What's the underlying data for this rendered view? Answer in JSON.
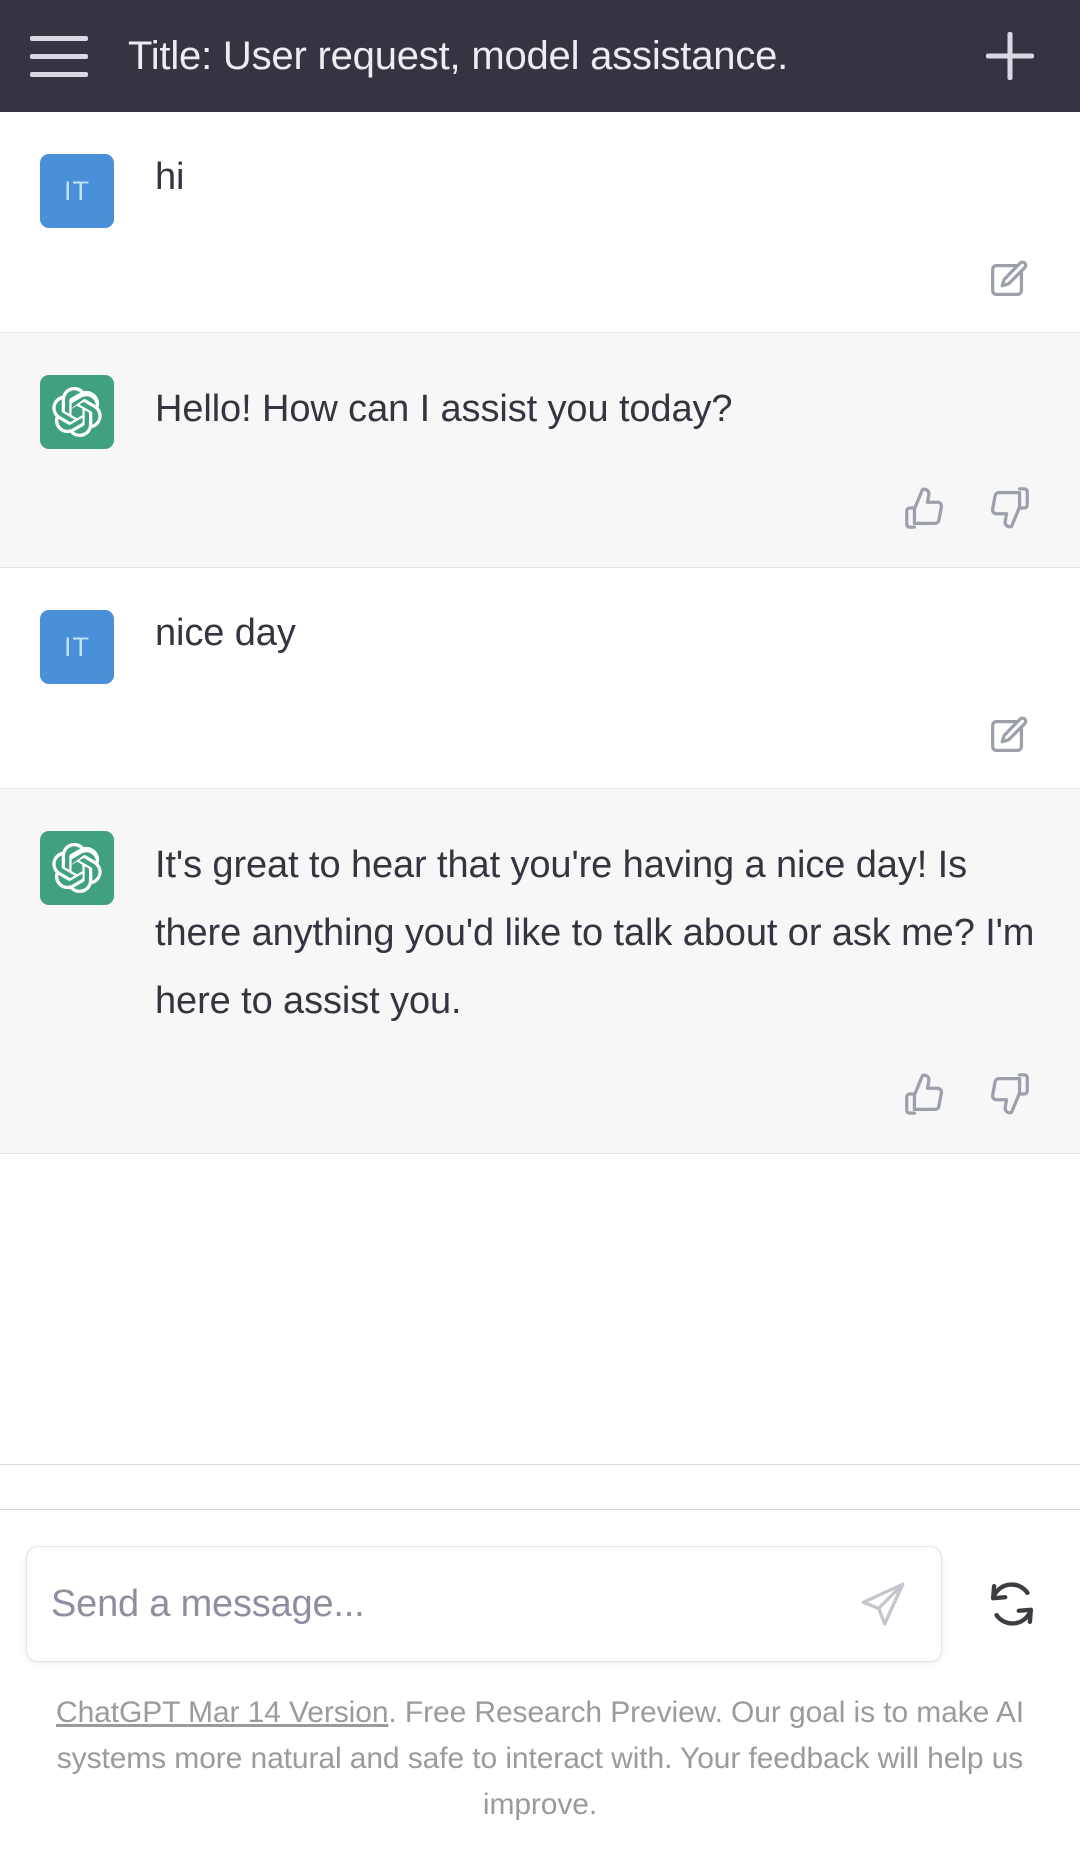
{
  "header": {
    "menu_icon": "hamburger-menu-icon",
    "title": "Title: User request, model assistance.",
    "new_chat_icon": "plus-icon"
  },
  "conversation": [
    {
      "role": "user",
      "avatar_initials": "IT",
      "avatar_color": "#4a90d9",
      "text": "hi",
      "actions": [
        {
          "icon": "edit-icon",
          "label": "Edit message"
        }
      ]
    },
    {
      "role": "assistant",
      "avatar_icon": "openai-logo-icon",
      "avatar_color": "#41a07f",
      "text": "Hello! How can I assist you today?",
      "actions": [
        {
          "icon": "thumbs-up-icon",
          "label": "Good response"
        },
        {
          "icon": "thumbs-down-icon",
          "label": "Bad response"
        }
      ]
    },
    {
      "role": "user",
      "avatar_initials": "IT",
      "avatar_color": "#4a90d9",
      "text": "nice day",
      "actions": [
        {
          "icon": "edit-icon",
          "label": "Edit message"
        }
      ]
    },
    {
      "role": "assistant",
      "avatar_icon": "openai-logo-icon",
      "avatar_color": "#41a07f",
      "text": "It's great to hear that you're having a nice day! Is there anything you'd like to talk about or ask me? I'm here to assist you.",
      "actions": [
        {
          "icon": "thumbs-up-icon",
          "label": "Good response"
        },
        {
          "icon": "thumbs-down-icon",
          "label": "Bad response"
        }
      ]
    }
  ],
  "composer": {
    "placeholder": "Send a message...",
    "value": "",
    "send_icon": "send-paper-plane-icon",
    "regenerate_icon": "refresh-regenerate-icon"
  },
  "footer": {
    "version_link": "ChatGPT Mar 14 Version",
    "disclaimer": ". Free Research Preview. Our goal is to make AI systems more natural and safe to interact with. Your feedback will help us improve."
  },
  "colors": {
    "header_bg": "#343541",
    "header_text": "#ececf1",
    "user_row_bg": "#ffffff",
    "assistant_row_bg": "#f7f7f8",
    "body_text": "#343541",
    "muted_text": "#8e8ea0",
    "icon_gray": "#9ca0ab",
    "user_avatar": "#4a90d9",
    "assistant_avatar": "#41a07f"
  }
}
